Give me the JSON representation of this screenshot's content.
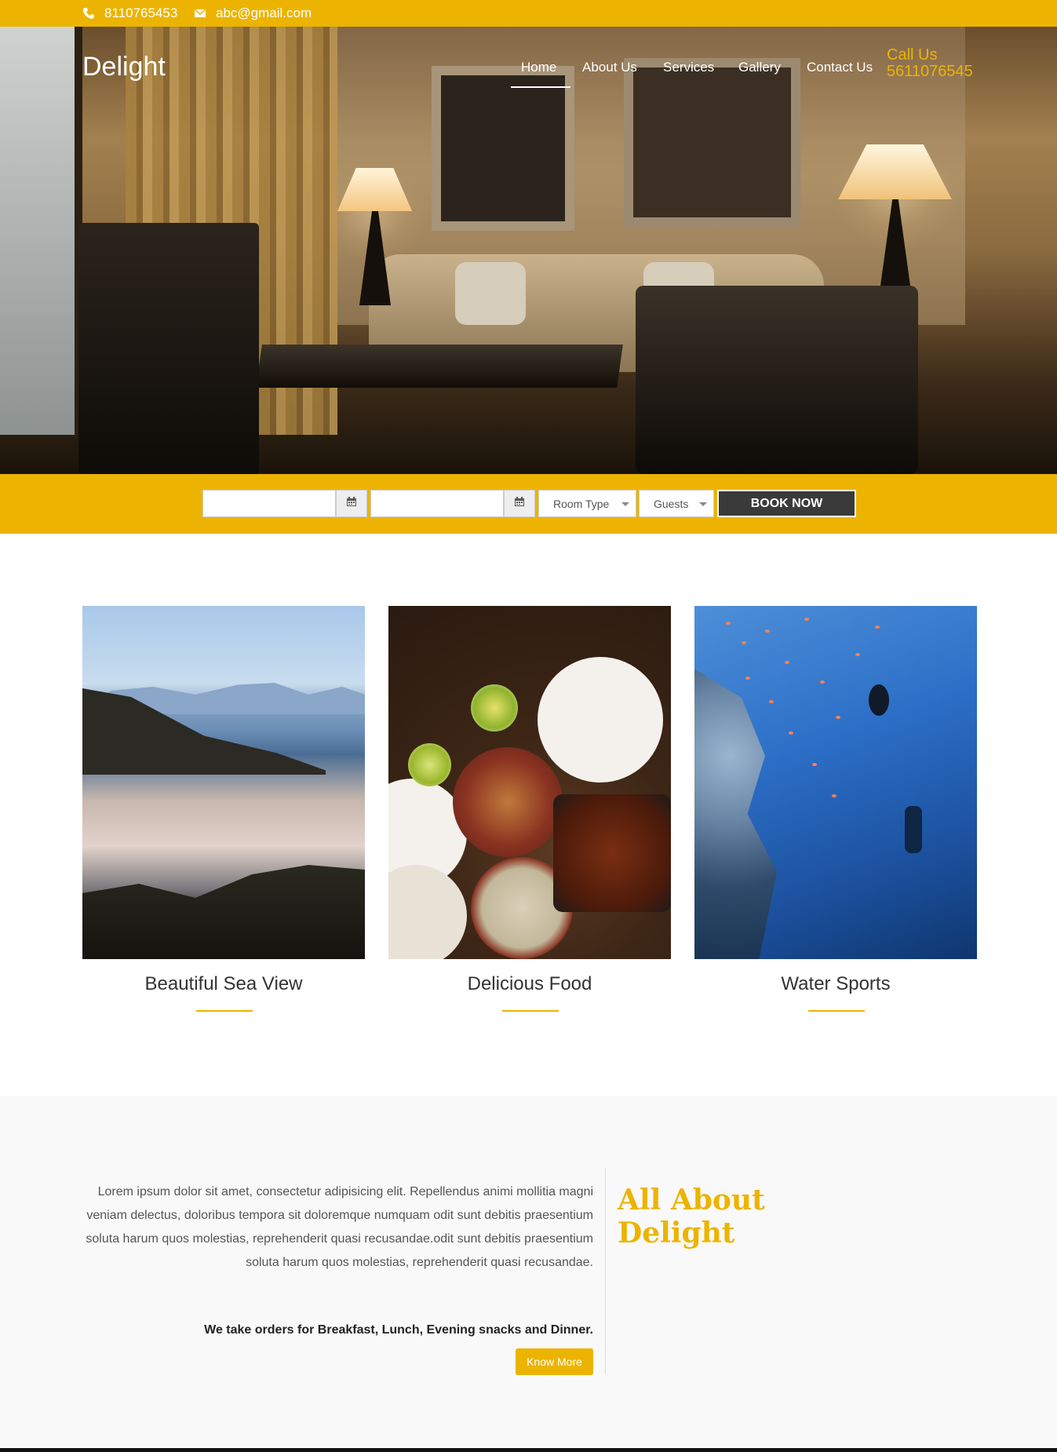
{
  "topbar": {
    "phone": "8110765453",
    "email": "abc@gmail.com",
    "phone_icon": "phone-icon",
    "email_icon": "envelope-icon"
  },
  "nav": {
    "brand": "Delight",
    "items": [
      {
        "label": "Home",
        "active": true
      },
      {
        "label": "About Us",
        "active": false
      },
      {
        "label": "Services",
        "active": false
      },
      {
        "label": "Gallery",
        "active": false
      },
      {
        "label": "Contact Us",
        "active": false
      }
    ],
    "call_label": "Call Us",
    "call_number": "5611076545"
  },
  "booking": {
    "checkin_value": "",
    "checkout_value": "",
    "room_type": "Room Type",
    "guests": "Guests",
    "book_label": "BOOK NOW",
    "calendar_icon": "calendar-icon"
  },
  "features": [
    {
      "title": "Beautiful Sea View"
    },
    {
      "title": "Delicious Food"
    },
    {
      "title": "Water Sports"
    }
  ],
  "about": {
    "paragraph": "Lorem ipsum dolor sit amet, consectetur adipisicing elit. Repellendus animi mollitia magni veniam delectus, doloribus tempora sit doloremque numquam odit sunt debitis praesentium soluta harum quos molestias, reprehenderit quasi recusandae.odit sunt debitis praesentium soluta harum quos molestias, reprehenderit quasi recusandae.",
    "orders": "We take orders for Breakfast, Lunch, Evening snacks and Dinner.",
    "button": "Know More",
    "heading_line1": "All About",
    "heading_line2": "Delight"
  },
  "colors": {
    "accent": "#ecb400",
    "dark_button": "#3a3a3a",
    "about_bg": "#f9f9f9"
  }
}
